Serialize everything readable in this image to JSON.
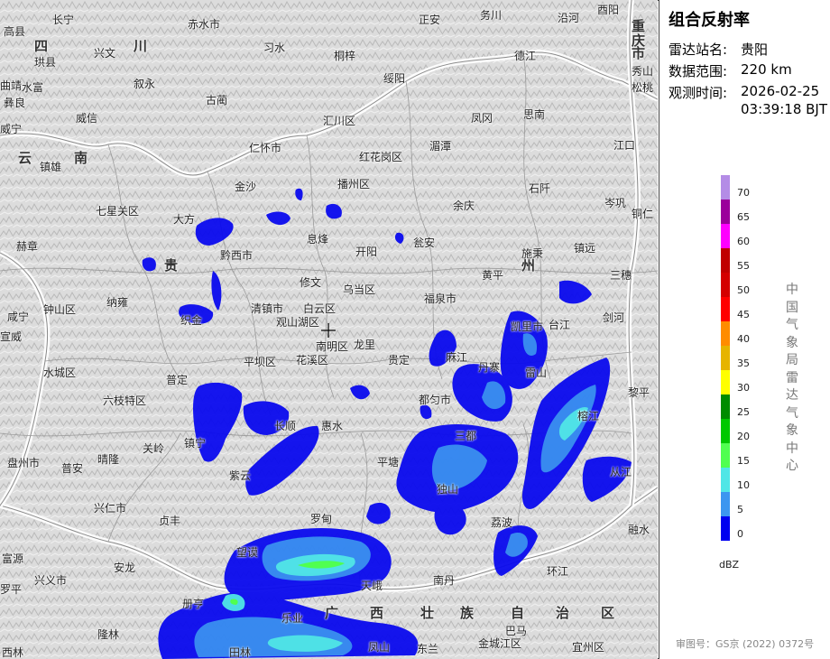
{
  "panel": {
    "title": "组合反射率",
    "station_label": "雷达站名:",
    "station_value": "贵阳",
    "range_label": "数据范围:",
    "range_value": "220 km",
    "time_label": "观测时间:",
    "time_date": "2026-02-25",
    "time_clock": "03:39:18 BJT",
    "legend_unit": "dBZ",
    "legend_ticks": [
      "70",
      "65",
      "60",
      "55",
      "50",
      "45",
      "40",
      "35",
      "30",
      "25",
      "20",
      "15",
      "10",
      "5",
      "0"
    ],
    "legend_colors": [
      "#b48ce6",
      "#9b009b",
      "#ff00ff",
      "#c00000",
      "#d40000",
      "#ff0000",
      "#ff8c00",
      "#e6b400",
      "#ffff00",
      "#008c00",
      "#00c800",
      "#50ff50",
      "#50e6e6",
      "#3c96f0",
      "#0000f0"
    ],
    "agency": "中国气象局雷达气象中心",
    "approval": "审图号：GS京 (2022) 0372号"
  },
  "map": {
    "regions": [
      "四",
      "川",
      "云",
      "南",
      "贵",
      "州",
      "重",
      "庆",
      "市",
      "广",
      "西",
      "壮",
      "族",
      "自",
      "治",
      "区"
    ],
    "cities": [
      "长宁",
      "珙县",
      "高县",
      "兴文",
      "叙永",
      "古蔺",
      "赤水市",
      "习水",
      "桐梓",
      "绥阳",
      "正安",
      "务川",
      "德江",
      "沿河",
      "酉阳",
      "秀山",
      "松桃",
      "江口",
      "思南",
      "凤冈",
      "湄潭",
      "汇川区",
      "仁怀市",
      "红花岗区",
      "播州区",
      "金沙",
      "余庆",
      "石阡",
      "岑巩",
      "铜仁",
      "镇雄",
      "彝良",
      "威信",
      "七星关区",
      "大方",
      "黔西市",
      "息烽",
      "开阳",
      "瓮安",
      "黄平",
      "施秉",
      "镇远",
      "三穗",
      "赫章",
      "纳雍",
      "织金",
      "修文",
      "清镇市",
      "白云区",
      "乌当区",
      "福泉市",
      "凯里市",
      "台江",
      "剑河",
      "钟山区",
      "观山湖区",
      "南明区",
      "龙里",
      "贵定",
      "麻江",
      "丹寨",
      "雷山",
      "榕江",
      "黎平",
      "水城区",
      "平坝区",
      "花溪区",
      "六枝特区",
      "普定",
      "长顺",
      "惠水",
      "都匀市",
      "三都",
      "从江",
      "盘州市",
      "普安",
      "晴隆",
      "关岭",
      "镇宁",
      "紫云",
      "平塘",
      "独山",
      "荔波",
      "兴仁市",
      "贞丰",
      "望谟",
      "罗甸",
      "南丹",
      "环江",
      "融水",
      "富源",
      "罗平",
      "兴义市",
      "安龙",
      "册亨",
      "天峨",
      "乐业",
      "凤山",
      "金城江区",
      "宜州区",
      "西林",
      "隆林",
      "田林",
      "东兰",
      "巴马",
      "威宁",
      "水富",
      "曲靖",
      "宣威",
      "咸宁"
    ]
  }
}
